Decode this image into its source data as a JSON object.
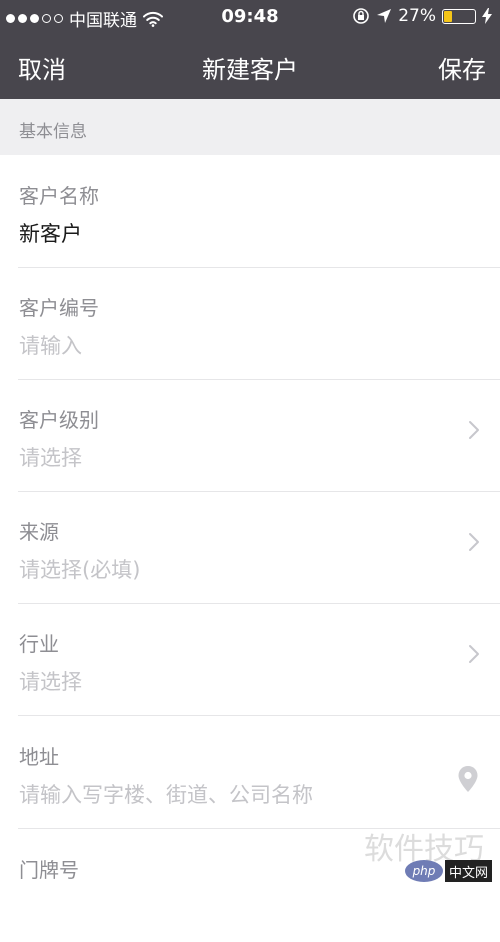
{
  "status_bar": {
    "carrier": "中国联通",
    "time": "09:48",
    "battery": "27%",
    "battery_level": 0.27,
    "signal_bars_filled": 3,
    "signal_bars_total": 5
  },
  "nav": {
    "cancel": "取消",
    "title": "新建客户",
    "save": "保存"
  },
  "section": {
    "title": "基本信息"
  },
  "fields": [
    {
      "label": "客户名称",
      "value": "新客户"
    },
    {
      "label": "客户编号",
      "placeholder": "请输入"
    },
    {
      "label": "客户级别",
      "placeholder": "请选择",
      "icon": "chevron-right-icon"
    },
    {
      "label": "来源",
      "placeholder": "请选择(必填)",
      "icon": "chevron-right-icon"
    },
    {
      "label": "行业",
      "placeholder": "请选择",
      "icon": "chevron-right-icon"
    },
    {
      "label": "地址",
      "placeholder": "请输入写字楼、街道、公司名称",
      "icon": "location-pin-icon"
    },
    {
      "label": "门牌号"
    }
  ],
  "watermark": {
    "text": "软件技巧",
    "logo_php": "php",
    "logo_cn": "中文网"
  },
  "colors": {
    "header_bg": "#48464d",
    "section_bg": "#efeff1",
    "label": "#8e8e93",
    "placeholder": "#c4c4c8",
    "battery": "#f5c518"
  }
}
